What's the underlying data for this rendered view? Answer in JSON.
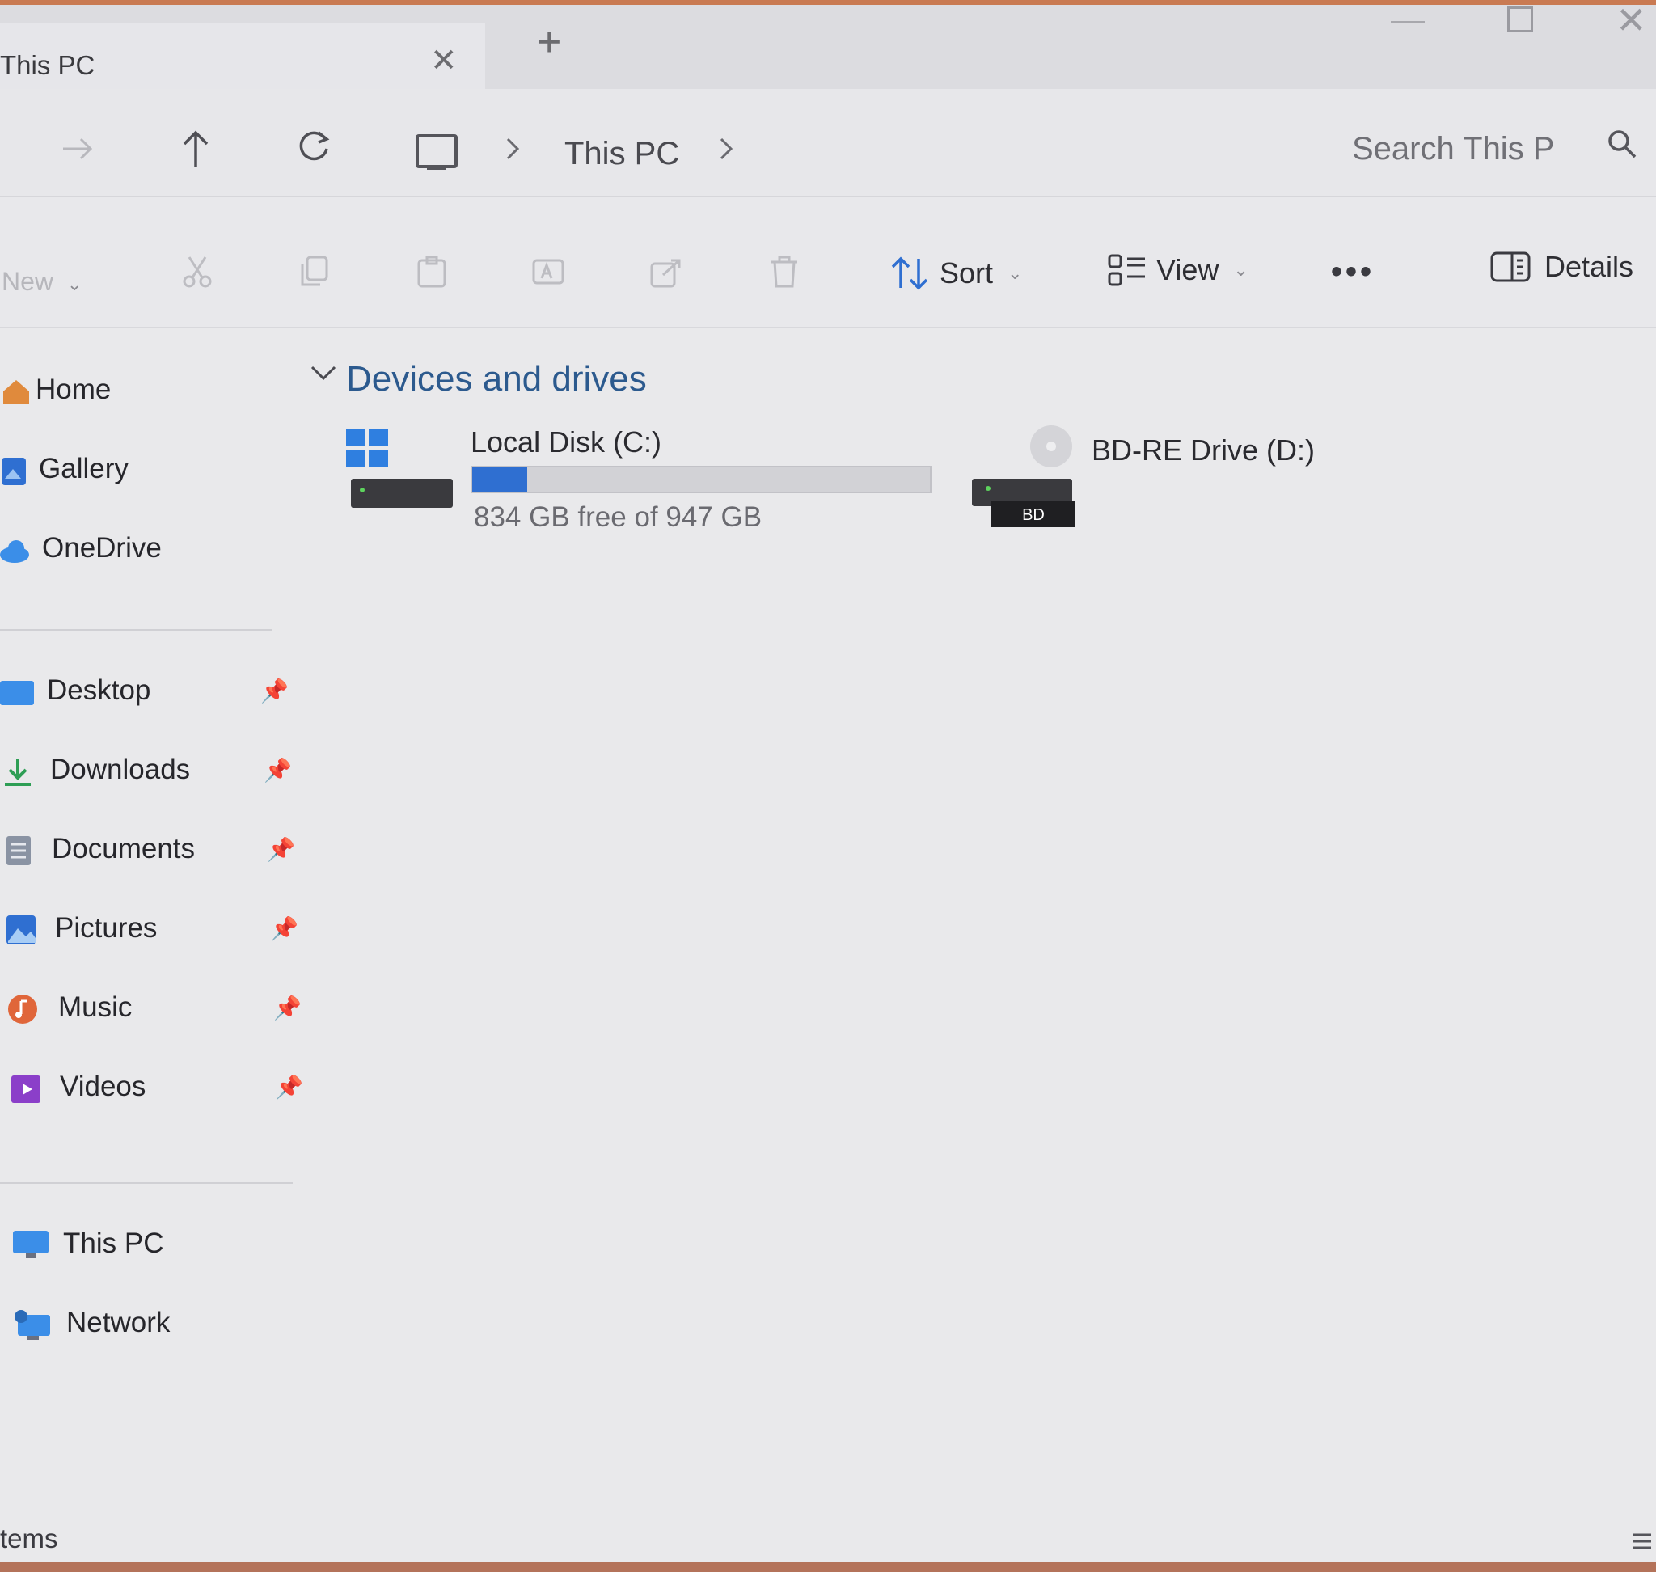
{
  "window": {
    "tab_title": "This PC",
    "tab_close_glyph": "✕",
    "new_tab_glyph": "+",
    "close_glyph": "✕"
  },
  "address": {
    "breadcrumb": [
      "This PC"
    ],
    "search_placeholder": "Search This P",
    "icons": [
      "arrow-forward-icon",
      "arrow-up-icon",
      "refresh-icon",
      "computer-icon",
      "chevron-right-icon",
      "search-icon"
    ]
  },
  "command_bar": {
    "new_label": "New",
    "sort_label": "Sort",
    "view_label": "View",
    "more_label": "•••",
    "details_label": "Details",
    "disabled_icons": [
      "cut-icon",
      "copy-icon",
      "paste-icon",
      "rename-icon",
      "share-icon",
      "delete-icon"
    ]
  },
  "sidebar": {
    "top_items": [
      {
        "label": "Home",
        "icon": "home-icon"
      },
      {
        "label": "Gallery",
        "icon": "gallery-icon"
      },
      {
        "label": "OneDrive",
        "icon": "onedrive-icon"
      }
    ],
    "pinned_items": [
      {
        "label": "Desktop",
        "icon": "desktop-icon"
      },
      {
        "label": "Downloads",
        "icon": "downloads-icon"
      },
      {
        "label": "Documents",
        "icon": "documents-icon"
      },
      {
        "label": "Pictures",
        "icon": "pictures-icon"
      },
      {
        "label": "Music",
        "icon": "music-icon"
      },
      {
        "label": "Videos",
        "icon": "videos-icon"
      }
    ],
    "bottom_items": [
      {
        "label": "This PC",
        "icon": "this-pc-icon"
      },
      {
        "label": "Network",
        "icon": "network-icon"
      }
    ],
    "pin_glyph": "📌"
  },
  "content": {
    "group_title": "Devices and drives",
    "drives": [
      {
        "name": "Local Disk (C:)",
        "space_text": "834 GB free of 947 GB",
        "used_fraction": 0.12,
        "icon": "windows-drive-icon"
      },
      {
        "name": "BD-RE Drive (D:)",
        "badge": "BD",
        "icon": "bd-drive-icon"
      }
    ]
  },
  "status_bar": {
    "text": "tems"
  },
  "colors": {
    "accent": "#2f6fd1",
    "group_title": "#2c5a8e",
    "background": "#e9e9eb"
  }
}
